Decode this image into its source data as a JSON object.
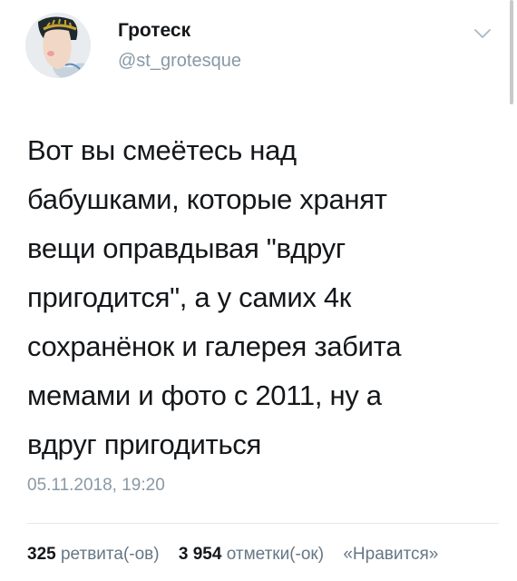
{
  "author": {
    "display_name": "Гротеск",
    "handle": "@st_grotesque",
    "avatar_icon": "avatar-portrait-laurel-wreath"
  },
  "tweet": {
    "text": "Вот вы смеётесь над\nбабушками, которые хранят\nвещи оправдывая \"вдруг\nпригодится\", а у самих 4к\nсохранёнок и галерея забита\nмемами и фото с 2011, ну а\nвдруг пригодиться",
    "timestamp": "05.11.2018, 19:20"
  },
  "stats": {
    "retweets_count": "325",
    "retweets_label": "ретвита(-ов)",
    "likes_count": "3 954",
    "likes_label": "отметки(-ок)",
    "likes_extra": "«Нравится»"
  },
  "icons": {
    "menu": "chevron-down-icon"
  },
  "colors": {
    "text": "#14171a",
    "secondary": "#8899a6",
    "divider": "#e1e8ed"
  }
}
